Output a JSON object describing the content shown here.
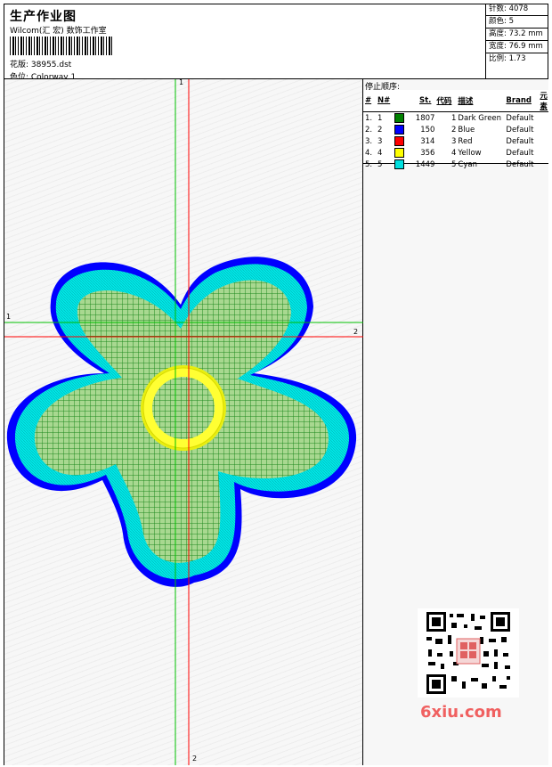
{
  "header": {
    "title": "生产作业图",
    "company": "Wilcom(汇 宏) 数饰工作室",
    "design_file": "花版: 38955.dst",
    "colorway": "色位: Colorway 1"
  },
  "stats": [
    "针数: 4078",
    "颜色: 5",
    "高度: 73.2 mm",
    "宽度: 76.9 mm",
    "比例: 1.73"
  ],
  "stop_sequence": {
    "title": "停止顺序:",
    "columns": [
      "#",
      "N#",
      "St.",
      "代码",
      "描述",
      "Brand",
      "元素"
    ],
    "rows": [
      {
        "idx": "1.",
        "n": "1",
        "color": "#008000",
        "st": "1807",
        "code": "1",
        "desc": "Dark Green",
        "brand": "Default"
      },
      {
        "idx": "2.",
        "n": "2",
        "color": "#0000ff",
        "st": "150",
        "code": "2",
        "desc": "Blue",
        "brand": "Default"
      },
      {
        "idx": "3.",
        "n": "3",
        "color": "#ff0000",
        "st": "314",
        "code": "3",
        "desc": "Red",
        "brand": "Default"
      },
      {
        "idx": "4.",
        "n": "4",
        "color": "#ffff00",
        "st": "356",
        "code": "4",
        "desc": "Yellow",
        "brand": "Default"
      },
      {
        "idx": "5.",
        "n": "5",
        "color": "#00e0e0",
        "st": "1449",
        "code": "5",
        "desc": "Cyan",
        "brand": "Default"
      }
    ]
  },
  "axes": {
    "green_top": "1",
    "green_left": "1",
    "red_right": "2",
    "red_bottom": "2"
  },
  "watermark": "6xiu.com",
  "colors": {
    "fill_green": "#008000",
    "outline_cyan": "#00e0e0",
    "outline_blue": "#0000ff",
    "ring_yellow": "#ffff00",
    "axis_green": "#00c000",
    "axis_red": "#ff0000"
  }
}
